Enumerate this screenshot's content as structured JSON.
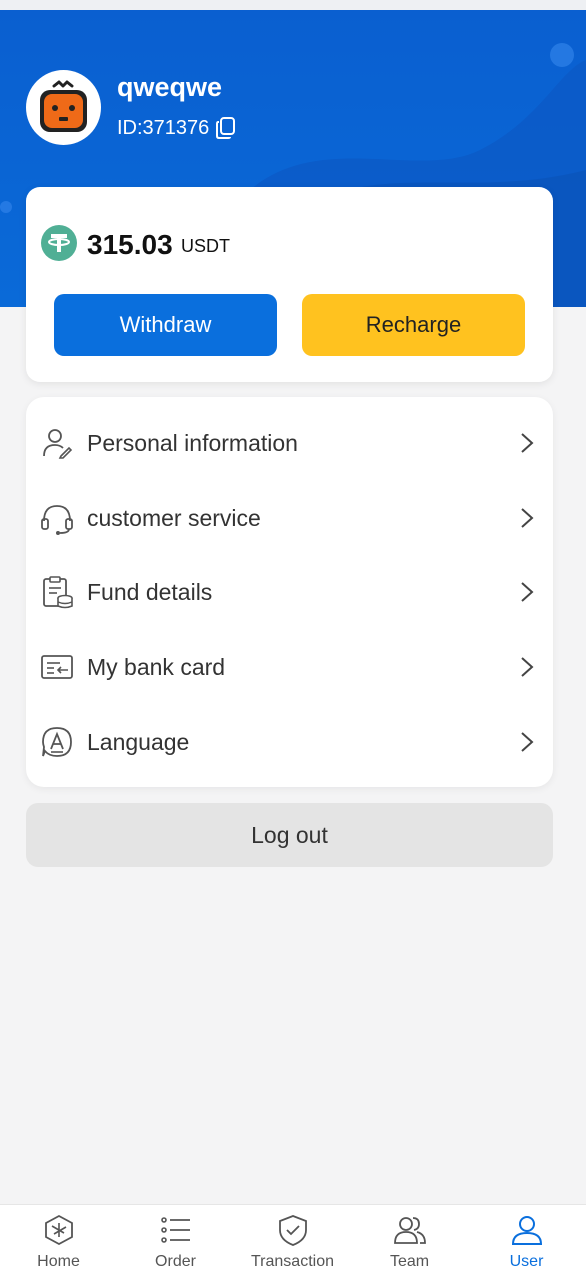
{
  "user": {
    "name": "qweqwe",
    "id_text": "ID:371376"
  },
  "balance": {
    "amount": "315.03",
    "currency": "USDT",
    "withdraw_label": "Withdraw",
    "recharge_label": "Recharge"
  },
  "menu": {
    "items": [
      {
        "label": "Personal information",
        "icon": "user-edit-icon"
      },
      {
        "label": "customer service",
        "icon": "headset-icon"
      },
      {
        "label": "Fund details",
        "icon": "ledger-icon"
      },
      {
        "label": "My bank card",
        "icon": "bank-card-icon"
      },
      {
        "label": "Language",
        "icon": "language-icon"
      }
    ]
  },
  "logout_label": "Log out",
  "tabbar": {
    "tabs": [
      {
        "label": "Home",
        "icon": "home-icon"
      },
      {
        "label": "Order",
        "icon": "list-icon"
      },
      {
        "label": "Transaction",
        "icon": "shield-check-icon"
      },
      {
        "label": "Team",
        "icon": "team-icon"
      },
      {
        "label": "User",
        "icon": "user-icon",
        "active": true
      }
    ]
  },
  "colors": {
    "brand_blue": "#0a6fdd",
    "recharge_yellow": "#ffc21f",
    "usdt_green": "#50af95",
    "avatar_orange": "#ef6a18"
  }
}
